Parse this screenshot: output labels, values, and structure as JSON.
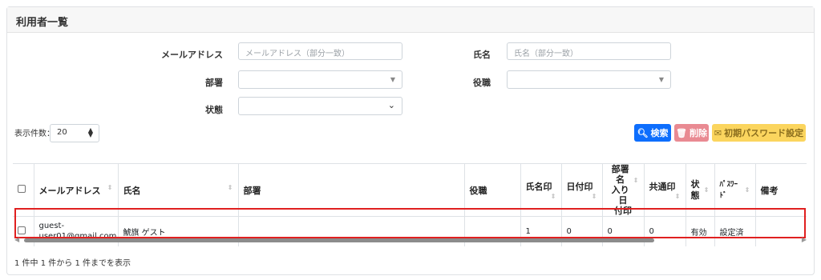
{
  "card": {
    "title": "利用者一覧"
  },
  "search": {
    "email_label": "メールアドレス",
    "email_placeholder": "メールアドレス（部分一致）",
    "name_label": "氏名",
    "name_placeholder": "氏名（部分一致）",
    "dept_label": "部署",
    "dept_value": "",
    "role_label": "役職",
    "role_value": "",
    "status_label": "状態",
    "status_value": ""
  },
  "display": {
    "label": "表示件数：",
    "value": "20"
  },
  "buttons": {
    "search": "検索",
    "delete": "削除",
    "reset_password": "初期パスワード設定"
  },
  "table": {
    "headers": [
      "メールアドレス",
      "氏名",
      "部署",
      "役職",
      "氏名印",
      "日付印",
      "部署名入り日付印",
      "共通印",
      "状態",
      "ﾊﾟｽﾜｰﾄﾞ",
      "備考"
    ],
    "header_dept_stamp_lines": [
      "部署名",
      "入り日",
      "付印"
    ],
    "header_status_lines": [
      "状",
      "態"
    ],
    "header_password_lines": [
      "ﾊﾟｽﾜｰ",
      "ﾄﾞ"
    ],
    "rows": [
      {
        "email_lines": [
          "guest-",
          "user01@gmail.com"
        ],
        "name": "鯱旗 ゲスト",
        "dept": "",
        "role": "",
        "name_stamp": "1",
        "date_stamp": "0",
        "dept_date_stamp": "0",
        "common_stamp": "0",
        "status": "有効",
        "password": "設定済",
        "note": ""
      }
    ]
  },
  "footer": {
    "summary": "1 件中 1 件から 1 件までを表示"
  },
  "colors": {
    "primary": "#0d6efd",
    "danger": "#e98a92",
    "warning": "#fbd55e",
    "highlight": "#e02020"
  }
}
